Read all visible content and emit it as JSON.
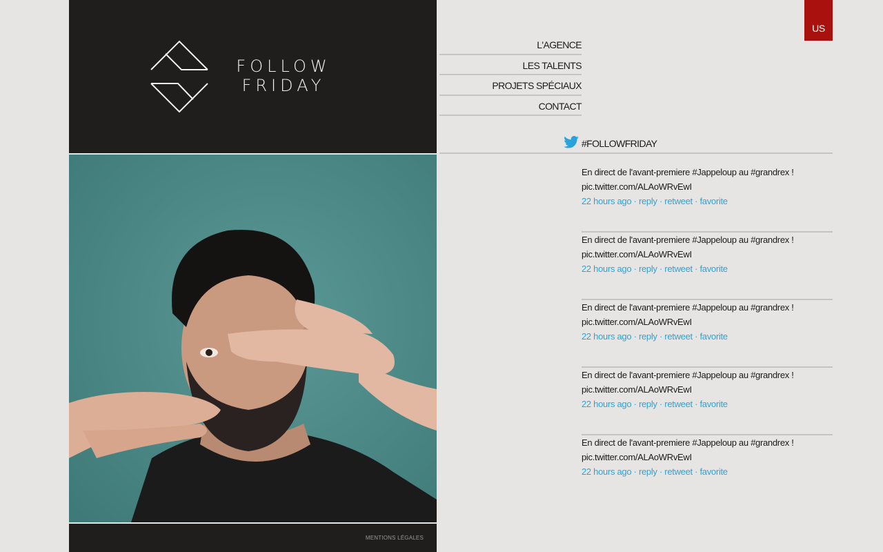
{
  "brand": {
    "line1": "FOLLOW",
    "line2": "FRIDAY"
  },
  "nav": {
    "items": [
      {
        "label": "L'AGENCE"
      },
      {
        "label": "LES TALENTS"
      },
      {
        "label": "PROJETS SPÉCIAUX"
      },
      {
        "label": "CONTACT"
      }
    ]
  },
  "lang": {
    "label": "US"
  },
  "twitter": {
    "icon": "twitter-bird-icon",
    "title": "#FOLLOWFRIDAY",
    "tweets": [
      {
        "line1": "En direct de l'avant-premiere #Jappeloup au #grandrex !",
        "line2": "pic.twitter.com/ALAoWRvEwI",
        "time": "22 hours ago",
        "reply": "reply",
        "retweet": "retweet",
        "favorite": "favorite"
      },
      {
        "line1": "En direct de l'avant-premiere #Jappeloup au #grandrex !",
        "line2": "pic.twitter.com/ALAoWRvEwI",
        "time": "22 hours ago",
        "reply": "reply",
        "retweet": "retweet",
        "favorite": "favorite"
      },
      {
        "line1": "En direct de l'avant-premiere #Jappeloup au #grandrex !",
        "line2": "pic.twitter.com/ALAoWRvEwI",
        "time": "22 hours ago",
        "reply": "reply",
        "retweet": "retweet",
        "favorite": "favorite"
      },
      {
        "line1": "En direct de l'avant-premiere #Jappeloup au #grandrex !",
        "line2": "pic.twitter.com/ALAoWRvEwI",
        "time": "22 hours ago",
        "reply": "reply",
        "retweet": "retweet",
        "favorite": "favorite"
      },
      {
        "line1": "En direct de l'avant-premiere #Jappeloup au #grandrex !",
        "line2": "pic.twitter.com/ALAoWRvEwI",
        "time": "22 hours ago",
        "reply": "reply",
        "retweet": "retweet",
        "favorite": "favorite"
      }
    ]
  },
  "footer": {
    "legal": "MENTIONS LÉGALES"
  },
  "colors": {
    "dark_panel": "#1f1e1d",
    "accent_red": "#a8110e",
    "link_blue": "#2aa4d8",
    "background": "#e6e5e4",
    "photo_teal": "#4f8c8a"
  }
}
